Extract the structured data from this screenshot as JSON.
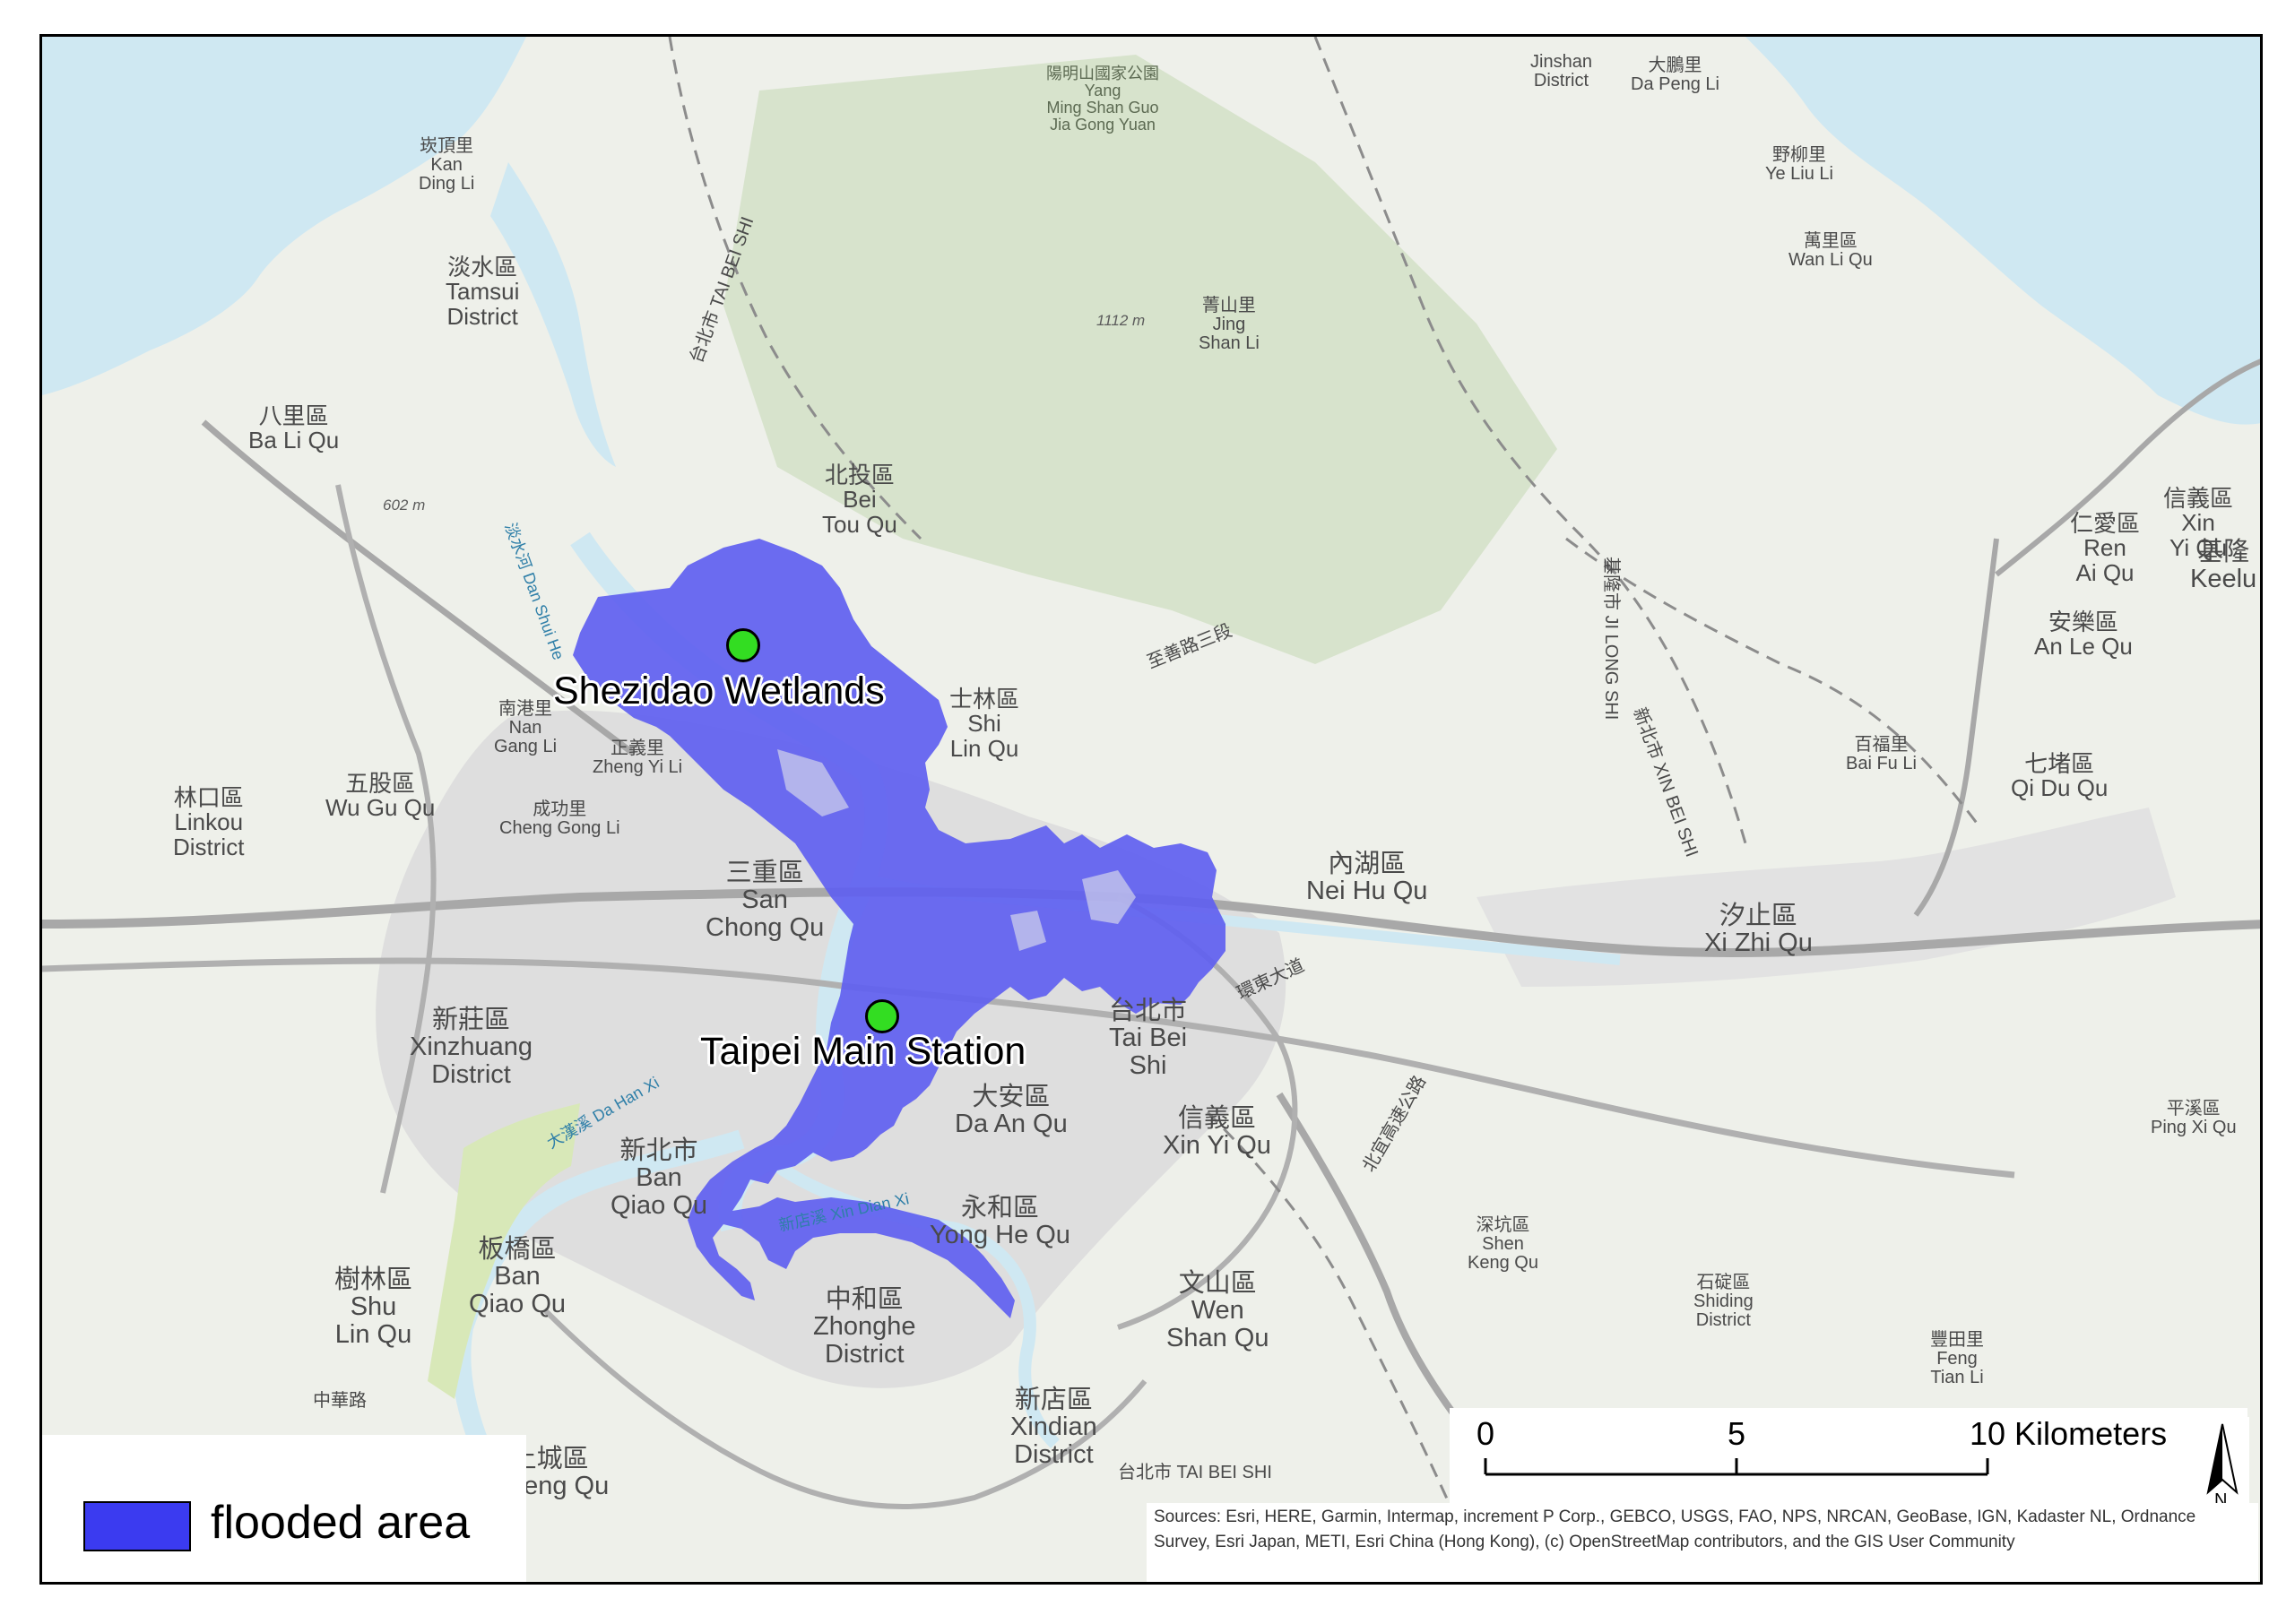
{
  "colors": {
    "flood": "#5f5ff0",
    "legend_swatch": "#3b3bf0",
    "poi_dot": "#33dd22",
    "water": "#cfe8f2",
    "land": "#eef0ea",
    "urban": "#dedede",
    "park": "#d7e3cc"
  },
  "points_of_interest": [
    {
      "label": "Shezidao Wetlands",
      "icon": "green-circle-marker"
    },
    {
      "label": "Taipei Main Station",
      "icon": "green-circle-marker"
    }
  ],
  "map_labels": {
    "yangmingshan": "陽明山國家公園\nYang\nMing Shan Guo\nJia Gong Yuan",
    "jinshan": "Jinshan\nDistrict",
    "dapeng": "大鵬里\nDa Peng Li",
    "yeliu": "野柳里\nYe Liu Li",
    "wanli": "萬里區\nWan Li Qu",
    "kanding": "崁頂里\nKan\nDing Li",
    "tamsui": "淡水區\nTamsui\nDistrict",
    "jingshan": "菁山里\nJing\nShan Li",
    "bali": "八里區\nBa Li Qu",
    "beitou": "北投區\nBei\nTou Qu",
    "shilin": "士林區\nShi\nLin Qu",
    "nangang_li": "南港里\nNan\nGang Li",
    "zhengyi": "正義里\nZheng Yi Li",
    "chenggong": "成功里\nCheng Gong Li",
    "wugu": "五股區\nWu Gu Qu",
    "linkou": "林口區\nLinkou\nDistrict",
    "sanchong": "三重區\nSan\nChong Qu",
    "neihu": "內湖區\nNei Hu Qu",
    "xinyi_keelung": "信義區\nXin\nYi Qu",
    "renai": "仁愛區\nRen\nAi Qu",
    "keelung": "基隆\nKeelu",
    "anle": "安樂區\nAn Le Qu",
    "baifu": "百福里\nBai Fu Li",
    "qidu": "七堵區\nQi Du Qu",
    "xizhi": "汐止區\nXi Zhi Qu",
    "xinzhuang": "新莊區\nXinzhuang\nDistrict",
    "taipei_city": "台北市\nTai Bei\nShi",
    "daan": "大安區\nDa An Qu",
    "xinyi_taipei": "信義區\nXin Yi Qu",
    "new_taipei": "新北市\nBan\nQiao Qu",
    "banqiao": "板橋區\nBan\nQiao Qu",
    "yonghe": "永和區\nYong He Qu",
    "shenkeng": "深坑區\nShen\nKeng Qu",
    "shiding": "石碇區\nShiding\nDistrict",
    "pingxi": "平溪區\nPing Xi Qu",
    "shulin": "樹林區\nShu\nLin Qu",
    "zhonghe": "中和區\nZhonghe\nDistrict",
    "wenshan": "文山區\nWen\nShan Qu",
    "fengtian": "豐田里\nFeng\nTian Li",
    "xindian": "新店區\nXindian\nDistrict",
    "tucheng": "土城區\nCheng Qu",
    "zhonghua_rd": "中華路",
    "taibei_shi_bottom": "台北市 TAI BEI SHI",
    "elev_602": "602 m",
    "elev_1112": "1112 m",
    "danshui_river": "淡水河 Dan Shui He",
    "dahan_river": "大漢溪 Da Han Xi",
    "xindian_river": "新店溪 Xin Dian Xi",
    "zhishan_rd": "至善路三段",
    "huandong": "環東大道",
    "keelung_city": "基隆市 JI LONG SHI",
    "xinbei_shi": "新北市 XIN BEI SHI",
    "taibei_shi_park": "台北市 TAI BEI SHI",
    "tunnel": "北宜高速公路"
  },
  "legend": {
    "label": "flooded area"
  },
  "scale_bar": {
    "ticks": [
      "0",
      "5",
      "10 Kilometers"
    ],
    "values_km": [
      0,
      5,
      10
    ]
  },
  "north_arrow": {
    "label": "N"
  },
  "attribution": "Sources: Esri, HERE, Garmin, Intermap, increment P Corp., GEBCO, USGS, FAO, NPS, NRCAN, GeoBase, IGN, Kadaster NL, Ordnance Survey, Esri Japan, METI, Esri China (Hong Kong), (c) OpenStreetMap contributors, and the GIS User Community"
}
